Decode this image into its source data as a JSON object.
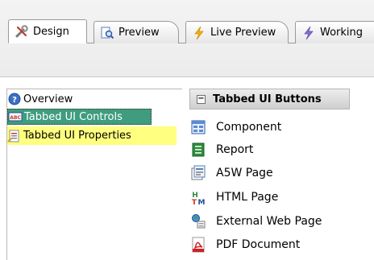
{
  "tabs": [
    {
      "label": "Design",
      "icon": "tools-icon"
    },
    {
      "label": "Preview",
      "icon": "magnifier-page-icon"
    },
    {
      "label": "Live Preview",
      "icon": "lightning-icon"
    },
    {
      "label": "Working",
      "icon": "lightning-icon"
    }
  ],
  "tree": {
    "items": [
      {
        "label": "Overview",
        "icon": "help-icon"
      },
      {
        "label": "Tabbed UI Controls",
        "icon": "abc-controls-icon"
      },
      {
        "label": "Tabbed UI Properties",
        "icon": "properties-icon"
      }
    ]
  },
  "panel": {
    "title": "Tabbed UI Buttons",
    "collapse_glyph": "−",
    "items": [
      {
        "label": "Component",
        "icon": "component-icon"
      },
      {
        "label": "Report",
        "icon": "report-icon"
      },
      {
        "label": "A5W Page",
        "icon": "a5w-page-icon"
      },
      {
        "label": "HTML Page",
        "icon": "html-page-icon"
      },
      {
        "label": "External Web Page",
        "icon": "external-web-page-icon"
      },
      {
        "label": "PDF Document",
        "icon": "pdf-document-icon"
      }
    ]
  },
  "colors": {
    "selected_bg": "#3f9c7f",
    "hover_bg": "#ffff80",
    "lightning": "#f2b400"
  }
}
